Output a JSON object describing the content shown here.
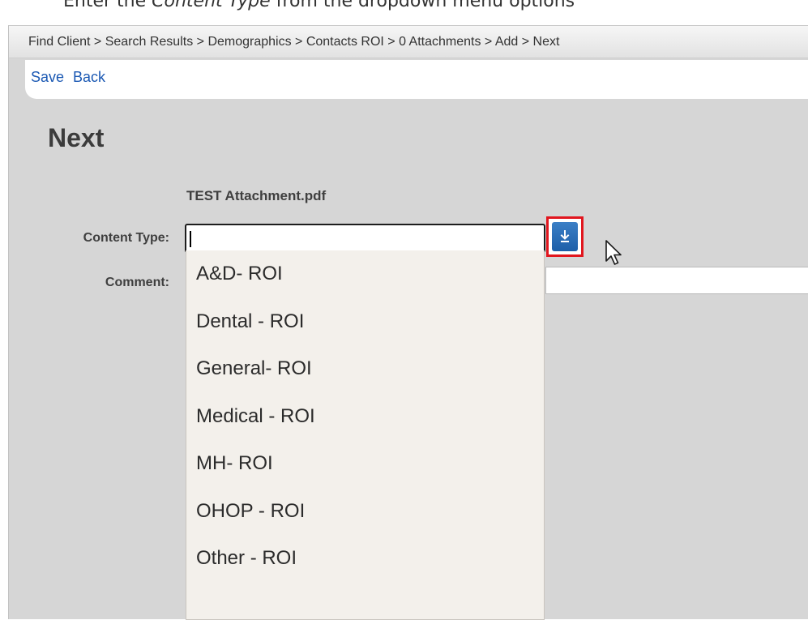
{
  "instruction": {
    "before": "Enter the ",
    "emphasis": "Content Type",
    "after": " from the dropdown menu options"
  },
  "breadcrumb": "Find Client > Search Results > Demographics > Contacts ROI > 0 Attachments > Add > Next",
  "actions": {
    "save": "Save",
    "back": "Back"
  },
  "page_title": "Next",
  "attachment": {
    "filename": "TEST Attachment.pdf"
  },
  "form": {
    "content_type_label": "Content Type:",
    "content_type_value": "",
    "comment_label": "Comment:",
    "comment_value": ""
  },
  "content_type_options": [
    "A&D- ROI",
    "Dental - ROI",
    "General- ROI",
    "Medical - ROI",
    "MH- ROI",
    "OHOP - ROI",
    "Other - ROI"
  ],
  "colors": {
    "highlight_border": "#e1161e",
    "dropdown_button": "#1d5fa8",
    "link": "#1a58b3"
  },
  "icons": {
    "dropdown": "download-arrow-icon",
    "pointer": "mouse-pointer-icon"
  }
}
